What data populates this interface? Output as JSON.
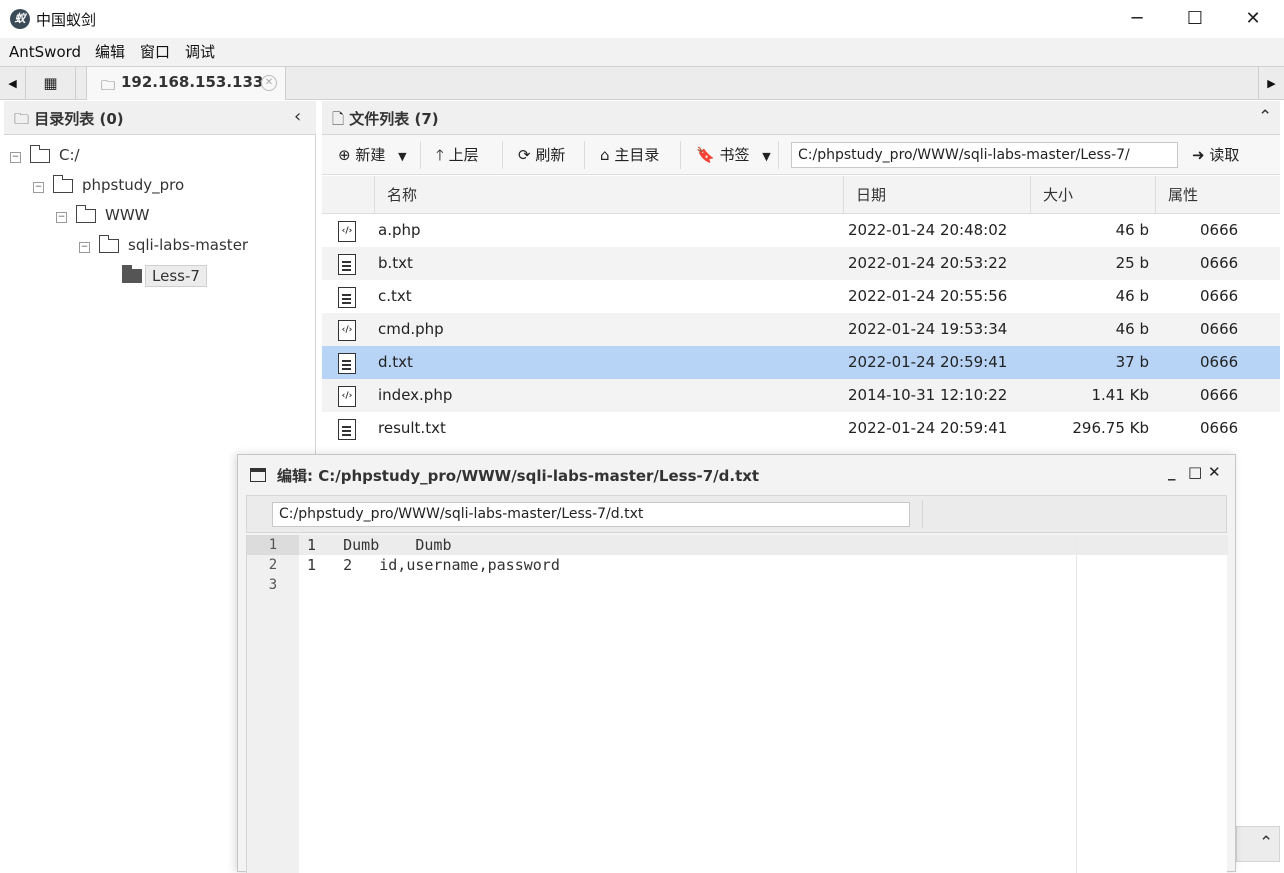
{
  "window": {
    "title": "中国蚁剑",
    "logo": "蚁",
    "minimize": "─",
    "maximize": "☐",
    "close": "✕"
  },
  "menu": [
    "AntSword",
    "编辑",
    "窗口",
    "调试"
  ],
  "tabs": {
    "left_arrow": "◀",
    "right_arrow": "▶",
    "home_icon": "▦",
    "host": "192.168.153.133",
    "host_close": "✕"
  },
  "dir_panel": {
    "title": "目录列表 (0)",
    "collapse": "‹",
    "tree": [
      {
        "label": "C:/",
        "level": 0,
        "toggle": "−"
      },
      {
        "label": "phpstudy_pro",
        "level": 1,
        "toggle": "−"
      },
      {
        "label": "WWW",
        "level": 2,
        "toggle": "−"
      },
      {
        "label": "sqli-labs-master",
        "level": 3,
        "toggle": "−"
      },
      {
        "label": "Less-7",
        "level": 4,
        "toggle": "",
        "selected": true
      }
    ]
  },
  "file_panel": {
    "title": "文件列表 (7)",
    "collapse": "⌃",
    "toolbar": {
      "new_label": "新建",
      "up_label": "上层",
      "refresh_label": "刷新",
      "home_label": "主目录",
      "bookmark_label": "书签",
      "path": "C:/phpstudy_pro/WWW/sqli-labs-master/Less-7/",
      "read_label": "读取"
    },
    "columns": [
      "名称",
      "日期",
      "大小",
      "属性"
    ],
    "files": [
      {
        "name": "a.php",
        "date": "2022-01-24 20:48:02",
        "size": "46 b",
        "attr": "0666",
        "type": "code"
      },
      {
        "name": "b.txt",
        "date": "2022-01-24 20:53:22",
        "size": "25 b",
        "attr": "0666",
        "type": "text"
      },
      {
        "name": "c.txt",
        "date": "2022-01-24 20:55:56",
        "size": "46 b",
        "attr": "0666",
        "type": "text"
      },
      {
        "name": "cmd.php",
        "date": "2022-01-24 19:53:34",
        "size": "46 b",
        "attr": "0666",
        "type": "code"
      },
      {
        "name": "d.txt",
        "date": "2022-01-24 20:59:41",
        "size": "37 b",
        "attr": "0666",
        "type": "text",
        "selected": true
      },
      {
        "name": "index.php",
        "date": "2014-10-31 12:10:22",
        "size": "1.41 Kb",
        "attr": "0666",
        "type": "code"
      },
      {
        "name": "result.txt",
        "date": "2022-01-24 20:59:41",
        "size": "296.75 Kb",
        "attr": "0666",
        "type": "text"
      }
    ]
  },
  "editor_dialog": {
    "title": "编辑: C:/phpstudy_pro/WWW/sqli-labs-master/Less-7/d.txt",
    "path": "C:/phpstudy_pro/WWW/sqli-labs-master/Less-7/d.txt",
    "minimize": "_",
    "maximize": "□",
    "close": "✕",
    "line_numbers": [
      "1",
      "2",
      "3"
    ],
    "lines": [
      "1   Dumb    Dumb",
      "1   2   id,username,password",
      ""
    ]
  },
  "bottom_collapse": "⌃"
}
